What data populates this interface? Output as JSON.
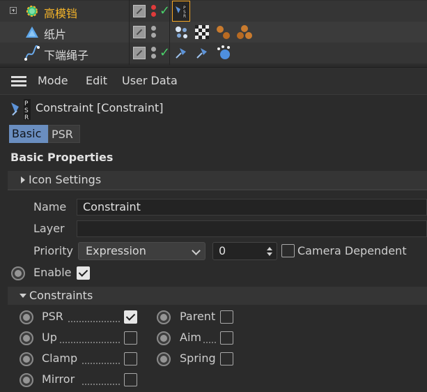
{
  "object_manager": {
    "rows": [
      {
        "name": "高模铛",
        "selected": true
      },
      {
        "name": "纸片",
        "selected": false
      },
      {
        "name": "下端绳子",
        "selected": false
      }
    ]
  },
  "menubar": {
    "mode": "Mode",
    "edit": "Edit",
    "user_data": "User Data"
  },
  "object_header": {
    "title": "Constraint [Constraint]"
  },
  "tabs": {
    "basic": "Basic",
    "psr": "PSR"
  },
  "basic_properties": {
    "title": "Basic Properties",
    "icon_settings": "Icon Settings",
    "name_label": "Name",
    "name_value": "Constraint",
    "layer_label": "Layer",
    "layer_value": "",
    "priority_label": "Priority",
    "priority_value": "Expression",
    "priority_number": "0",
    "camera_dependent_label": "Camera Dependent",
    "camera_dependent": false,
    "enable_label": "Enable",
    "enable": true
  },
  "constraints": {
    "title": "Constraints",
    "left": [
      {
        "label": "PSR",
        "checked": true
      },
      {
        "label": "Up",
        "checked": false
      },
      {
        "label": "Clamp",
        "checked": false
      },
      {
        "label": "Mirror",
        "checked": false
      }
    ],
    "right": [
      {
        "label": "Parent",
        "checked": false
      },
      {
        "label": "Aim",
        "checked": false
      },
      {
        "label": "Spring",
        "checked": false
      }
    ]
  },
  "colors": {
    "selected_object": "#f5b52a",
    "active_tab": "#6a8ec0",
    "checkmark_green": "#4bd26b"
  }
}
